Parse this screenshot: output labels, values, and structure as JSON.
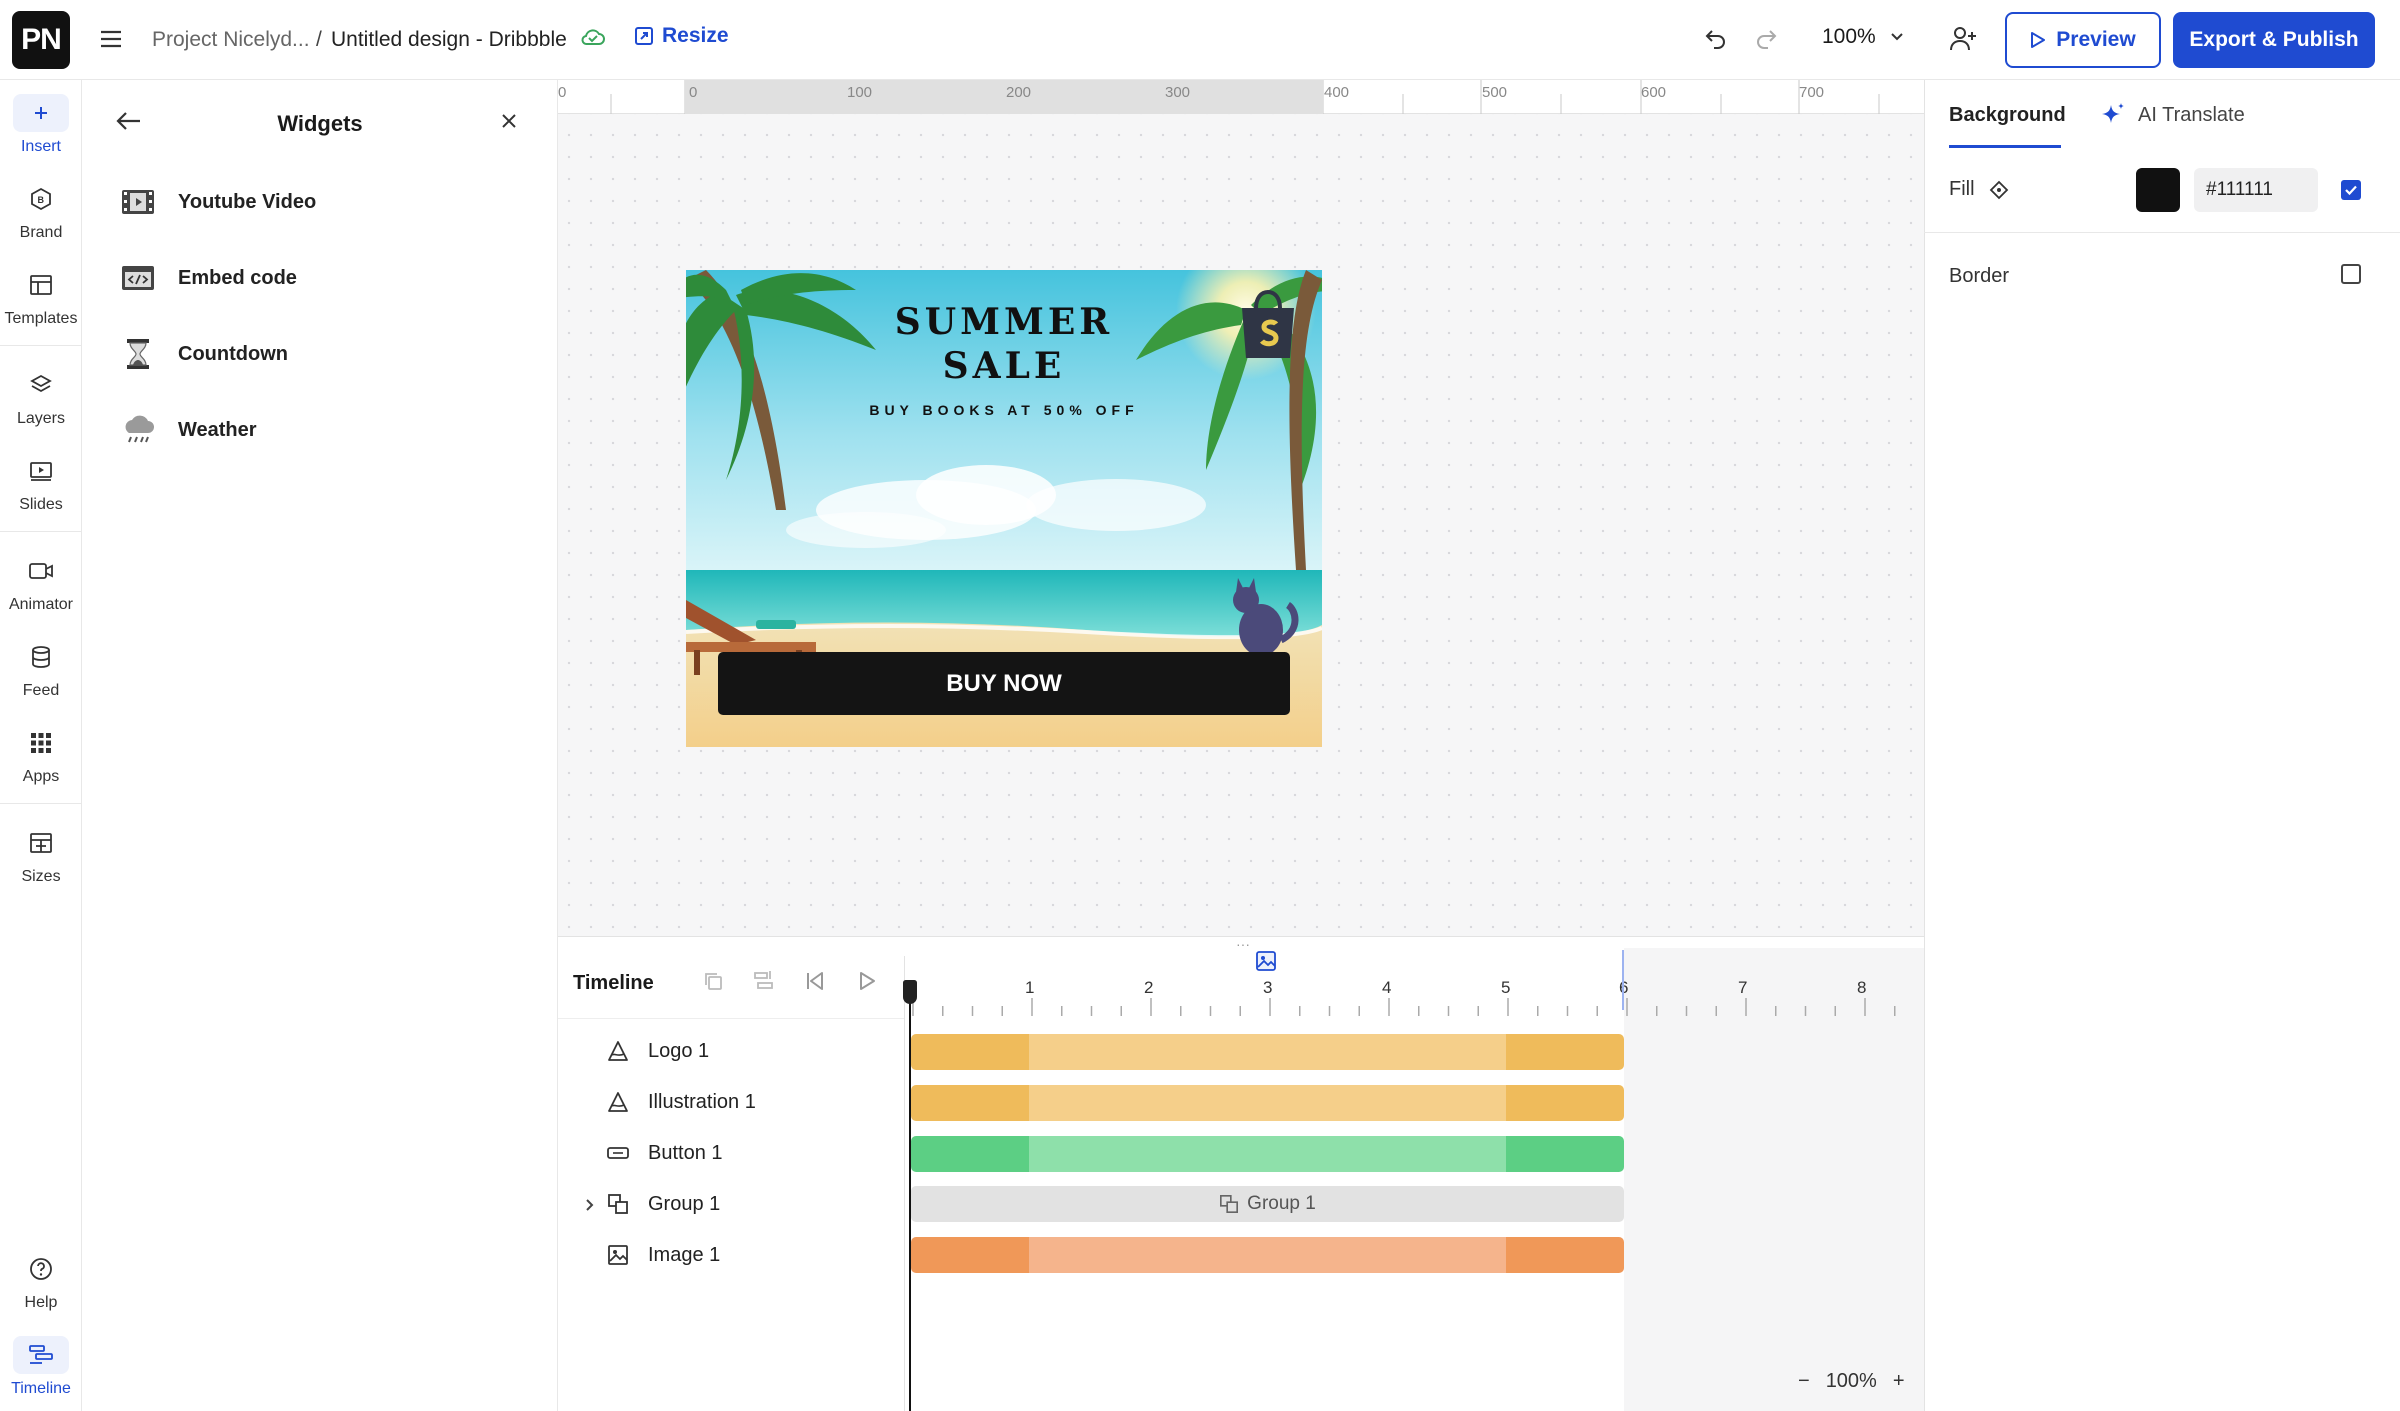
{
  "app": {
    "logo_text": "PN"
  },
  "breadcrumb": {
    "project": "Project Nicelyd...",
    "separator": "/",
    "design": "Untitled design - Dribbble"
  },
  "toolbar": {
    "resize_label": "Resize",
    "zoom": "100%",
    "preview_label": "Preview",
    "publish_label": "Export & Publish"
  },
  "rail": [
    {
      "label": "Insert",
      "icon": "plus-icon",
      "active": true
    },
    {
      "label": "Brand",
      "icon": "brand-icon"
    },
    {
      "label": "Templates",
      "icon": "templates-icon"
    },
    {
      "label": "Layers",
      "icon": "layers-icon"
    },
    {
      "label": "Slides",
      "icon": "slides-icon"
    },
    {
      "label": "Animator",
      "icon": "video-icon"
    },
    {
      "label": "Feed",
      "icon": "database-icon"
    },
    {
      "label": "Apps",
      "icon": "apps-grid-icon"
    },
    {
      "label": "Sizes",
      "icon": "sizes-icon"
    },
    {
      "label": "Help",
      "icon": "help-icon"
    },
    {
      "label": "Timeline",
      "icon": "timeline-icon",
      "active": true
    }
  ],
  "widgets": {
    "title": "Widgets",
    "items": [
      {
        "label": "Youtube Video",
        "icon": "film-icon"
      },
      {
        "label": "Embed code",
        "icon": "code-icon"
      },
      {
        "label": "Countdown",
        "icon": "hourglass-icon"
      },
      {
        "label": "Weather",
        "icon": "weather-icon"
      }
    ]
  },
  "ruler": {
    "labels": [
      "0",
      "0",
      "100",
      "200",
      "300",
      "400",
      "500",
      "600",
      "700"
    ]
  },
  "design": {
    "title_line1": "SUMMER",
    "title_line2": "SALE",
    "subtitle": "BUY BOOKS AT 50% OFF",
    "button_label": "BUY NOW"
  },
  "timeline": {
    "title": "Timeline",
    "ticks": [
      "1",
      "2",
      "3",
      "4",
      "5",
      "6",
      "7",
      "8"
    ],
    "layers": [
      {
        "name": "Logo 1",
        "icon": "logo-layer-icon",
        "bar": "orange-light"
      },
      {
        "name": "Illustration 1",
        "icon": "illustration-layer-icon",
        "bar": "orange-light"
      },
      {
        "name": "Button 1",
        "icon": "button-layer-icon",
        "bar": "green"
      },
      {
        "name": "Group 1",
        "icon": "group-layer-icon",
        "bar": "group"
      },
      {
        "name": "Image 1",
        "icon": "image-layer-icon",
        "bar": "orange"
      }
    ],
    "group_bar_label": "Group 1",
    "zoom": "100%",
    "zoom_minus": "−",
    "zoom_plus": "+"
  },
  "right_panel": {
    "tab_background": "Background",
    "tab_ai": "AI Translate",
    "fill_label": "Fill",
    "fill_hex": "#111111",
    "fill_enabled": true,
    "border_label": "Border",
    "border_enabled": false
  },
  "colors": {
    "accent": "#1f4bd1",
    "bar_orange_light": [
      "#efbb5b",
      "#f5cf8a"
    ],
    "bar_green": [
      "#5ccf84",
      "#8ee0aa"
    ],
    "bar_orange": [
      "#f09858",
      "#f5b48c"
    ],
    "fill": "#111111"
  }
}
